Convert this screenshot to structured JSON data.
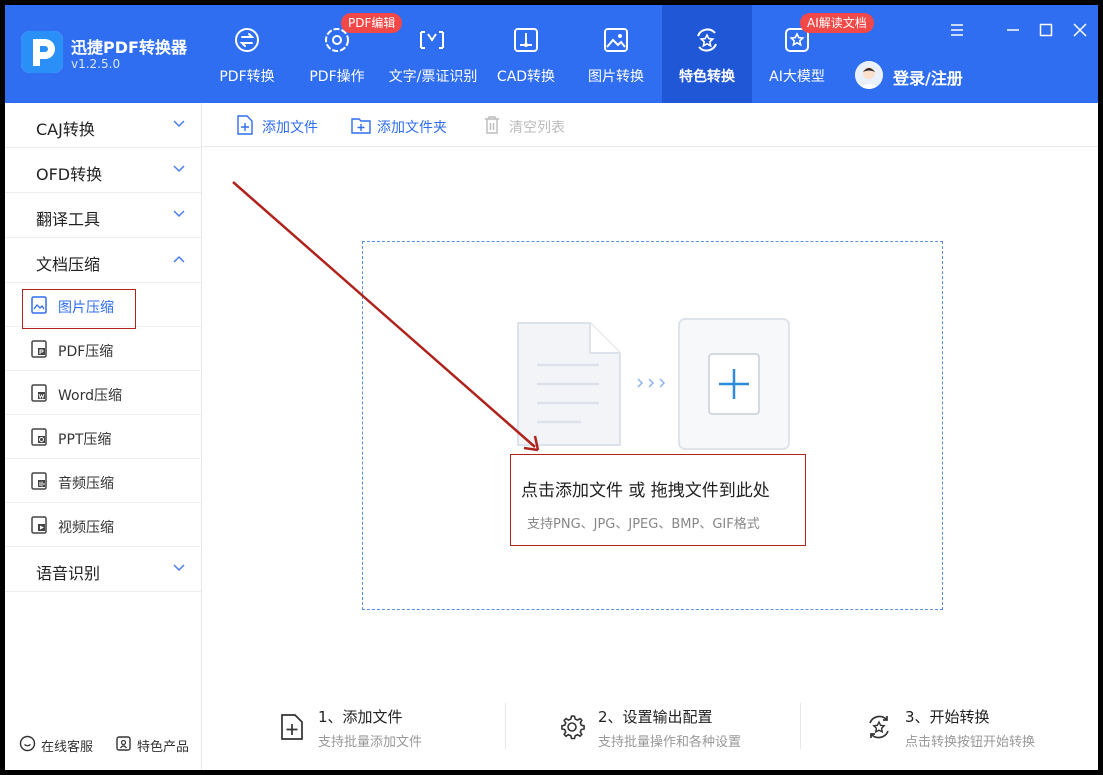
{
  "app": {
    "name": "迅捷PDF转换器",
    "version": "v1.2.5.0",
    "accent": "#2f6df1"
  },
  "nav": [
    {
      "label": "PDF转换",
      "icon": "pdf-convert-icon"
    },
    {
      "label": "PDF操作",
      "icon": "pdf-gear-icon",
      "badge": "PDF编辑"
    },
    {
      "label": "文字/票证识别",
      "icon": "ocr-scan-icon"
    },
    {
      "label": "CAD转换",
      "icon": "cad-icon"
    },
    {
      "label": "图片转换",
      "icon": "image-icon"
    },
    {
      "label": "特色转换",
      "icon": "star-cycle-icon",
      "active": true
    },
    {
      "label": "AI大模型",
      "icon": "ai-star-icon",
      "badge": "AI解读文档"
    }
  ],
  "user": {
    "login_label": "登录/注册"
  },
  "sidebar": {
    "categories": [
      {
        "label": "CAJ转换",
        "expanded": false
      },
      {
        "label": "OFD转换",
        "expanded": false
      },
      {
        "label": "翻译工具",
        "expanded": false
      },
      {
        "label": "文档压缩",
        "expanded": true
      },
      {
        "label": "语音识别",
        "expanded": false
      }
    ],
    "compress_items": [
      {
        "label": "图片压缩",
        "icon": "image-file-icon",
        "selected": true
      },
      {
        "label": "PDF压缩",
        "icon": "pdf-file-icon"
      },
      {
        "label": "Word压缩",
        "icon": "word-file-icon"
      },
      {
        "label": "PPT压缩",
        "icon": "ppt-file-icon"
      },
      {
        "label": "音频压缩",
        "icon": "audio-file-icon"
      },
      {
        "label": "视频压缩",
        "icon": "video-file-icon"
      }
    ],
    "footer": {
      "service": "在线客服",
      "products": "特色产品"
    }
  },
  "toolbar": {
    "add_file": "添加文件",
    "add_folder": "添加文件夹",
    "clear_list": "清空列表"
  },
  "dropzone": {
    "main_text": "点击添加文件 或 拖拽文件到此处",
    "hint": "支持PNG、JPG、JPEG、BMP、GIF格式"
  },
  "steps": [
    {
      "title": "1、添加文件",
      "desc": "支持批量添加文件"
    },
    {
      "title": "2、设置输出配置",
      "desc": "支持批量操作和各种设置"
    },
    {
      "title": "3、开始转换",
      "desc": "点击转换按钮开始转换"
    }
  ]
}
